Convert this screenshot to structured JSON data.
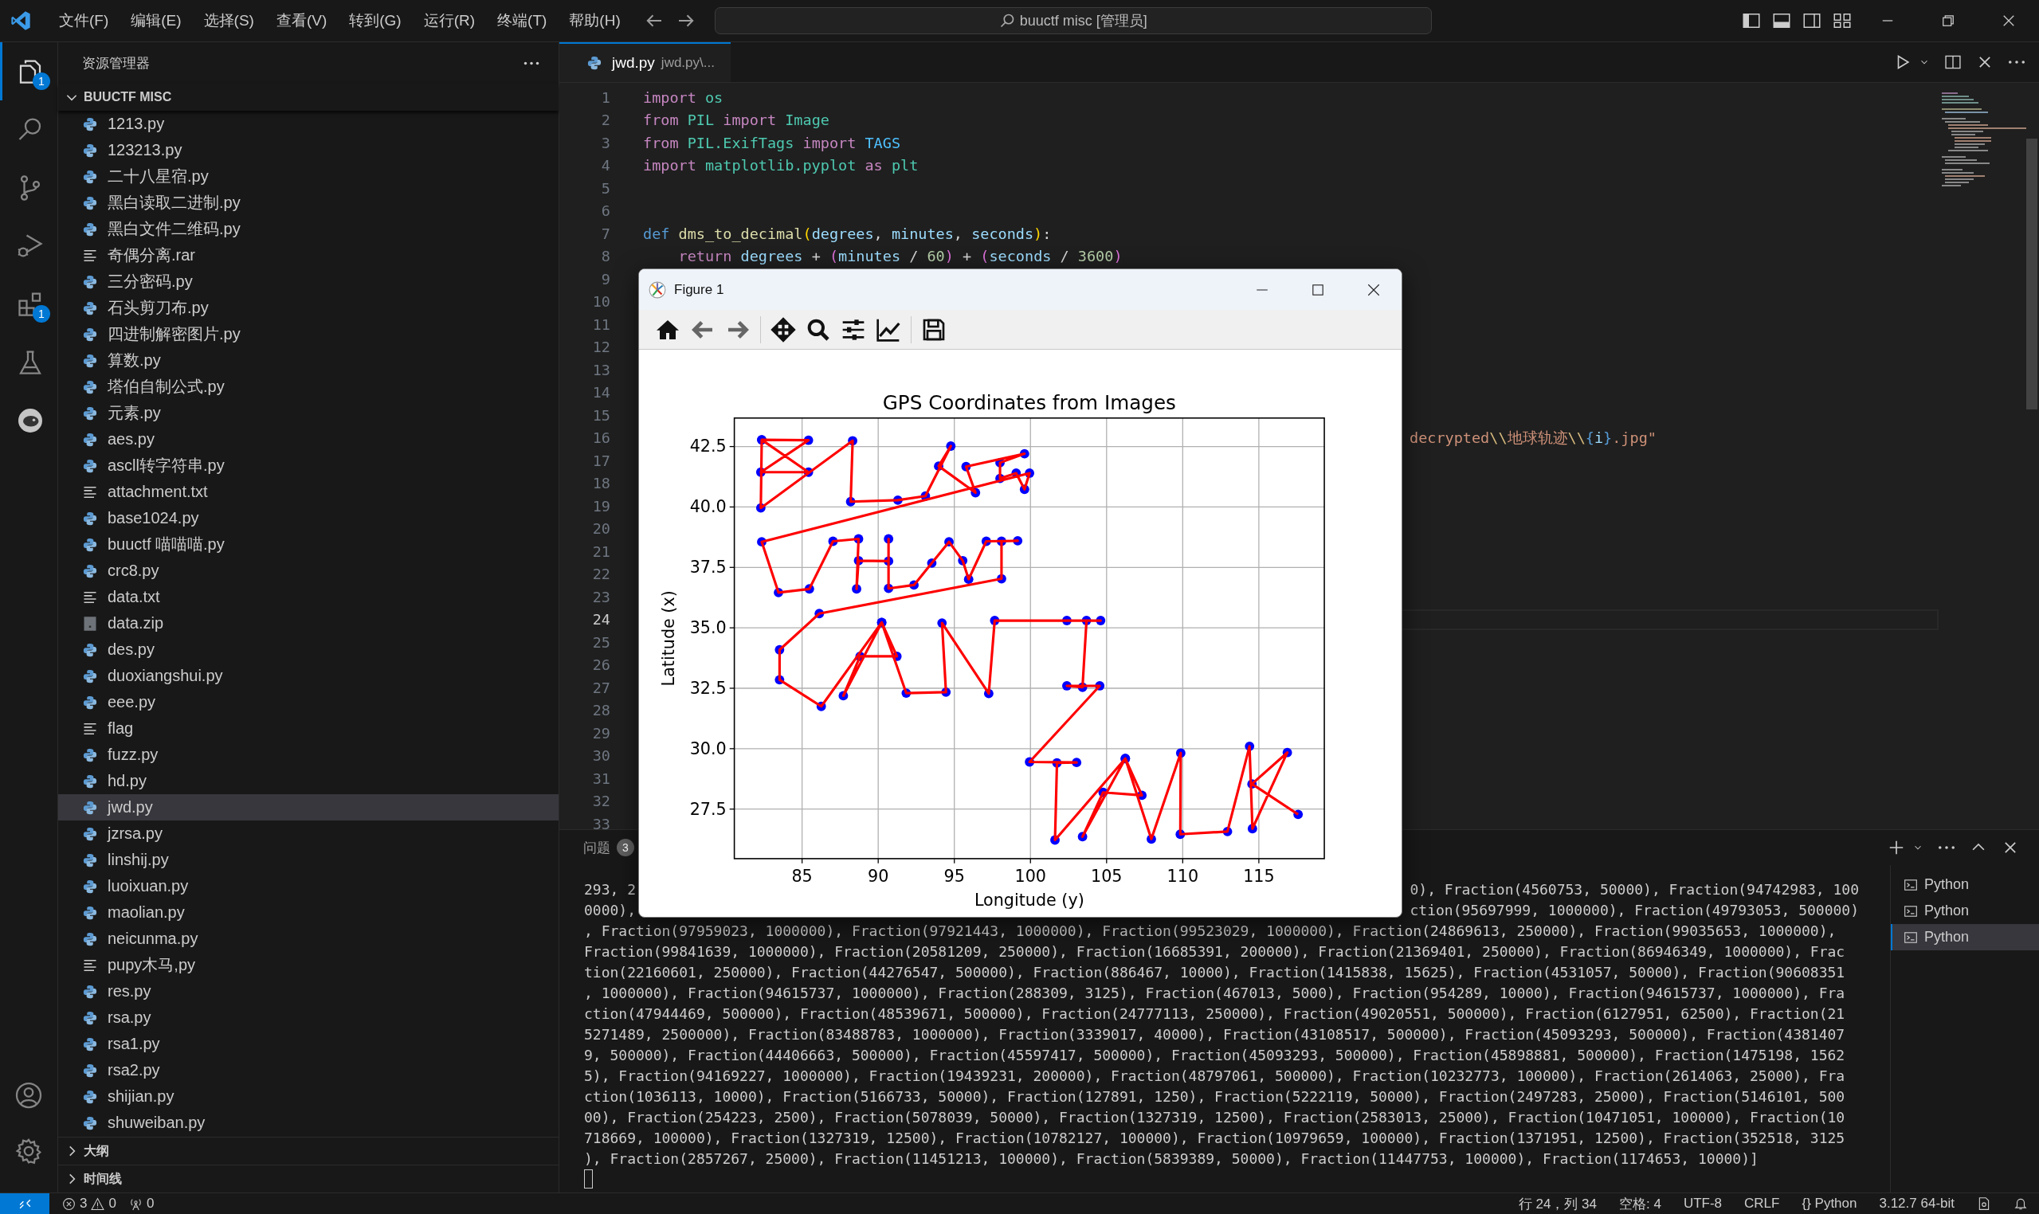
{
  "titlebar": {
    "menus": [
      "文件(F)",
      "编辑(E)",
      "选择(S)",
      "查看(V)",
      "转到(G)",
      "运行(R)",
      "终端(T)",
      "帮助(H)"
    ],
    "search": "buuctf misc [管理员]"
  },
  "activity_bar": {
    "items": [
      {
        "kind": "files",
        "badge": "1",
        "selected": true
      },
      {
        "kind": "search",
        "selected": false
      },
      {
        "kind": "source-control",
        "selected": false
      },
      {
        "kind": "run-debug",
        "selected": false
      },
      {
        "kind": "extensions",
        "badge": "1",
        "selected": false
      },
      {
        "kind": "testing",
        "selected": false
      },
      {
        "kind": "round-logo",
        "selected": false
      }
    ]
  },
  "sidebar": {
    "title": "资源管理器",
    "section": {
      "title": "BUUCTF MISC",
      "expanded": true
    },
    "files": [
      {
        "name": "1213.py",
        "kind": "python",
        "selected": false
      },
      {
        "name": "123213.py",
        "kind": "python",
        "selected": false
      },
      {
        "name": "二十八星宿.py",
        "kind": "python",
        "selected": false
      },
      {
        "name": "黑白读取二进制.py",
        "kind": "python",
        "selected": false
      },
      {
        "name": "黑白文件二维码.py",
        "kind": "python",
        "selected": false
      },
      {
        "name": "奇偶分离.rar",
        "kind": "text",
        "selected": false
      },
      {
        "name": "三分密码.py",
        "kind": "python",
        "selected": false
      },
      {
        "name": "石头剪刀布.py",
        "kind": "python",
        "selected": false
      },
      {
        "name": "四进制解密图片.py",
        "kind": "python",
        "selected": false
      },
      {
        "name": "算数.py",
        "kind": "python",
        "selected": false
      },
      {
        "name": "塔伯自制公式.py",
        "kind": "python",
        "selected": false
      },
      {
        "name": "元素.py",
        "kind": "python",
        "selected": false
      },
      {
        "name": "aes.py",
        "kind": "python",
        "selected": false
      },
      {
        "name": "ascll转字符串.py",
        "kind": "python",
        "selected": false
      },
      {
        "name": "attachment.txt",
        "kind": "text",
        "selected": false
      },
      {
        "name": "base1024.py",
        "kind": "python",
        "selected": false
      },
      {
        "name": "buuctf 喵喵喵.py",
        "kind": "python",
        "selected": false
      },
      {
        "name": "crc8.py",
        "kind": "python",
        "selected": false
      },
      {
        "name": "data.txt",
        "kind": "text",
        "selected": false
      },
      {
        "name": "data.zip",
        "kind": "archive",
        "selected": false
      },
      {
        "name": "des.py",
        "kind": "python",
        "selected": false
      },
      {
        "name": "duoxiangshui.py",
        "kind": "python",
        "selected": false
      },
      {
        "name": "eee.py",
        "kind": "python",
        "selected": false
      },
      {
        "name": "flag",
        "kind": "text",
        "selected": false
      },
      {
        "name": "fuzz.py",
        "kind": "python",
        "selected": false
      },
      {
        "name": "hd.py",
        "kind": "python",
        "selected": false
      },
      {
        "name": "jwd.py",
        "kind": "python",
        "selected": true
      },
      {
        "name": "jzrsa.py",
        "kind": "python",
        "selected": false
      },
      {
        "name": "linshij.py",
        "kind": "python",
        "selected": false
      },
      {
        "name": "luoixuan.py",
        "kind": "python",
        "selected": false
      },
      {
        "name": "maolian.py",
        "kind": "python",
        "selected": false
      },
      {
        "name": "neicunma.py",
        "kind": "python",
        "selected": false
      },
      {
        "name": "pupy木马,py",
        "kind": "text",
        "selected": false
      },
      {
        "name": "res.py",
        "kind": "python",
        "selected": false
      },
      {
        "name": "rsa.py",
        "kind": "python",
        "selected": false
      },
      {
        "name": "rsa1.py",
        "kind": "python",
        "selected": false
      },
      {
        "name": "rsa2.py",
        "kind": "python",
        "selected": false
      },
      {
        "name": "shijian.py",
        "kind": "python",
        "selected": false
      },
      {
        "name": "shuweiban.py",
        "kind": "python",
        "selected": false
      }
    ],
    "collapsed_sections": [
      {
        "title": "大纲",
        "expanded": false
      },
      {
        "title": "时间线",
        "expanded": false
      }
    ]
  },
  "editor": {
    "tab": {
      "name": "jwd.py",
      "path": "jwd.py\\..."
    },
    "lines": [
      {
        "n": "1",
        "current": false,
        "kind": "full",
        "tokens": [
          {
            "kind": "kw",
            "text": "import "
          },
          {
            "kind": "mod",
            "text": "os"
          }
        ]
      },
      {
        "n": "2",
        "current": false,
        "kind": "full",
        "tokens": [
          {
            "kind": "kw",
            "text": "from "
          },
          {
            "kind": "mod",
            "text": "PIL "
          },
          {
            "kind": "kw",
            "text": "import "
          },
          {
            "kind": "mod",
            "text": "Image"
          }
        ]
      },
      {
        "n": "3",
        "current": false,
        "kind": "full",
        "tokens": [
          {
            "kind": "kw",
            "text": "from "
          },
          {
            "kind": "mod",
            "text": "PIL.ExifTags "
          },
          {
            "kind": "kw",
            "text": "import "
          },
          {
            "kind": "const",
            "text": "TAGS"
          }
        ]
      },
      {
        "n": "4",
        "current": false,
        "kind": "full",
        "tokens": [
          {
            "kind": "kw",
            "text": "import "
          },
          {
            "kind": "mod",
            "text": "matplotlib.pyplot "
          },
          {
            "kind": "kw",
            "text": "as "
          },
          {
            "kind": "mod",
            "text": "plt"
          }
        ]
      },
      {
        "n": "5",
        "current": false,
        "kind": "full"
      },
      {
        "n": "6",
        "current": false,
        "kind": "full"
      },
      {
        "n": "7",
        "current": false,
        "kind": "full",
        "tokens": [
          {
            "kind": "def",
            "text": "def "
          },
          {
            "kind": "func",
            "text": "dms_to_decimal"
          },
          {
            "kind": "paren",
            "text": "("
          },
          {
            "kind": "var",
            "text": "degrees"
          },
          {
            "kind": "plain",
            "text": ", "
          },
          {
            "kind": "var",
            "text": "minutes"
          },
          {
            "kind": "plain",
            "text": ", "
          },
          {
            "kind": "var",
            "text": "seconds"
          },
          {
            "kind": "paren",
            "text": ")"
          },
          {
            "kind": "plain",
            "text": ":"
          }
        ]
      },
      {
        "n": "8",
        "current": false,
        "kind": "full",
        "tokens": [
          {
            "kind": "kw",
            "text": "    return "
          },
          {
            "kind": "var",
            "text": "degrees"
          },
          {
            "kind": "plain",
            "text": " + "
          },
          {
            "kind": "paren2",
            "text": "("
          },
          {
            "kind": "var",
            "text": "minutes"
          },
          {
            "kind": "plain",
            "text": " / "
          },
          {
            "kind": "num",
            "text": "60"
          },
          {
            "kind": "paren2",
            "text": ")"
          },
          {
            "kind": "plain",
            "text": " + "
          },
          {
            "kind": "paren2",
            "text": "("
          },
          {
            "kind": "var",
            "text": "seconds"
          },
          {
            "kind": "plain",
            "text": " / "
          },
          {
            "kind": "num",
            "text": "3600"
          },
          {
            "kind": "paren2",
            "text": ")"
          }
        ]
      },
      {
        "n": "9",
        "current": false,
        "kind": "full"
      },
      {
        "n": "10",
        "current": false,
        "kind": "full"
      },
      {
        "n": "11",
        "current": false,
        "kind": "full"
      },
      {
        "n": "12",
        "current": false,
        "kind": "full"
      },
      {
        "n": "13",
        "current": false,
        "kind": "full"
      },
      {
        "n": "14",
        "current": false,
        "kind": "full"
      },
      {
        "n": "15",
        "current": false,
        "kind": "full"
      },
      {
        "n": "16",
        "current": false,
        "kind": "tail",
        "tokens": [
          {
            "kind": "str",
            "text": "decrypted"
          },
          {
            "kind": "esc",
            "text": "\\\\"
          },
          {
            "kind": "str",
            "text": "地球轨迹"
          },
          {
            "kind": "esc",
            "text": "\\\\"
          },
          {
            "kind": "brace",
            "text": "{"
          },
          {
            "kind": "var",
            "text": "i"
          },
          {
            "kind": "brace",
            "text": "}"
          },
          {
            "kind": "str",
            "text": ".jpg\""
          }
        ]
      },
      {
        "n": "17",
        "current": false,
        "kind": "full"
      },
      {
        "n": "18",
        "current": false,
        "kind": "full"
      },
      {
        "n": "19",
        "current": false,
        "kind": "full"
      },
      {
        "n": "20",
        "current": false,
        "kind": "full"
      },
      {
        "n": "21",
        "current": false,
        "kind": "full"
      },
      {
        "n": "22",
        "current": false,
        "kind": "full"
      },
      {
        "n": "23",
        "current": false,
        "kind": "full"
      },
      {
        "n": "24",
        "current": true,
        "kind": "full"
      },
      {
        "n": "25",
        "current": false,
        "kind": "full"
      },
      {
        "n": "26",
        "current": false,
        "kind": "full"
      },
      {
        "n": "27",
        "current": false,
        "kind": "full"
      },
      {
        "n": "28",
        "current": false,
        "kind": "full"
      },
      {
        "n": "29",
        "current": false,
        "kind": "full"
      },
      {
        "n": "30",
        "current": false,
        "kind": "full"
      },
      {
        "n": "31",
        "current": false,
        "kind": "full"
      },
      {
        "n": "32",
        "current": false,
        "kind": "full"
      },
      {
        "n": "33",
        "current": false,
        "kind": "full"
      }
    ]
  },
  "panel": {
    "tabs": [
      {
        "label": "问题",
        "badge": "3",
        "selected": false
      }
    ],
    "terminal_lines": [
      {
        "segments": [
          "293, 2",
          "0), Fraction(4560753, 50000), Fraction(94742983, 100"
        ]
      },
      {
        "segments": [
          "0000),",
          "ction(95697999, 1000000), Fraction(49793053, 500000)"
        ]
      },
      {
        "segments": [
          ", Fraction(97959023, 1000000), Fraction(97921443, 1000000), Fraction(99523029, 1000000), Fraction(24869613, 250000), Fraction(99035653, 1000000),"
        ]
      },
      {
        "segments": [
          "Fraction(99841639, 1000000), Fraction(20581209, 250000), Fraction(16685391, 200000), Fraction(21369401, 250000), Fraction(86946349, 1000000), Frac"
        ]
      },
      {
        "segments": [
          "tion(22160601, 250000), Fraction(44276547, 500000), Fraction(886467, 10000), Fraction(1415838, 15625), Fraction(4531057, 50000), Fraction(90608351"
        ]
      },
      {
        "segments": [
          ", 1000000), Fraction(94615737, 1000000), Fraction(288309, 3125), Fraction(467013, 5000), Fraction(954289, 10000), Fraction(94615737, 1000000), Fra"
        ]
      },
      {
        "segments": [
          "ction(47944469, 500000), Fraction(48539671, 500000), Fraction(24777113, 250000), Fraction(49020551, 500000), Fraction(6127951, 62500), Fraction(21"
        ]
      },
      {
        "segments": [
          "5271489, 2500000), Fraction(83488783, 1000000), Fraction(3339017, 40000), Fraction(43108517, 500000), Fraction(45093293, 500000), Fraction(4381407"
        ]
      },
      {
        "segments": [
          "9, 500000), Fraction(44406663, 500000), Fraction(45597417, 500000), Fraction(45093293, 500000), Fraction(45898881, 500000), Fraction(1475198, 1562"
        ]
      },
      {
        "segments": [
          "5), Fraction(94169227, 1000000), Fraction(19439231, 200000), Fraction(48797061, 500000), Fraction(10232773, 100000), Fraction(2614063, 25000), Fra"
        ]
      },
      {
        "segments": [
          "ction(1036113, 10000), Fraction(5166733, 50000), Fraction(127891, 1250), Fraction(5222119, 50000), Fraction(2497283, 25000), Fraction(5146101, 500"
        ]
      },
      {
        "segments": [
          "00), Fraction(254223, 2500), Fraction(5078039, 50000), Fraction(1327319, 12500), Fraction(2583013, 25000), Fraction(10471051, 100000), Fraction(10"
        ]
      },
      {
        "segments": [
          "718669, 100000), Fraction(1327319, 12500), Fraction(10782127, 100000), Fraction(10979659, 100000), Fraction(1371951, 12500), Fraction(352518, 3125"
        ]
      },
      {
        "segments": [
          "), Fraction(2857267, 25000), Fraction(11451213, 100000), Fraction(5839389, 50000), Fraction(11447753, 100000), Fraction(1174653, 10000)]"
        ]
      }
    ],
    "terminals": [
      {
        "label": "Python",
        "selected": false
      },
      {
        "label": "Python",
        "selected": false
      },
      {
        "label": "Python",
        "selected": true
      }
    ]
  },
  "figure": {
    "title": "Figure 1",
    "chart_data": {
      "type": "line",
      "title": "GPS Coordinates from Images",
      "xlabel": "Longitude (y)",
      "ylabel": "Latitude (x)",
      "x": [
        82.35,
        85.42,
        82.29,
        85.42,
        82.35,
        82.29,
        88.32,
        88.19,
        91.29,
        93.1,
        94.77,
        93.97,
        96.39,
        95.77,
        99.61,
        98.0,
        98.0,
        99.06,
        99.61,
        99.94,
        82.35,
        83.45,
        85.48,
        87.03,
        88.71,
        88.58,
        88.71,
        90.68,
        90.68,
        90.68,
        92.35,
        93.52,
        94.65,
        95.55,
        95.94,
        97.1,
        99.16,
        98.1,
        98.1,
        86.13,
        83.52,
        83.52,
        86.26,
        90.23,
        87.71,
        88.81,
        91.23,
        90.23,
        91.84,
        94.45,
        94.19,
        97.26,
        97.65,
        102.39,
        104.61,
        103.68,
        103.42,
        102.39,
        104.55,
        99.94,
        103.03,
        101.74,
        101.61,
        106.23,
        103.42,
        104.77,
        107.32,
        106.23,
        107.94,
        109.87,
        109.84,
        112.94,
        114.39,
        114.58,
        116.87,
        114.55,
        117.58
      ],
      "series": [
        {
          "color": "#ff0000",
          "marker": "o",
          "values": [
            42.78,
            42.76,
            41.44,
            41.44,
            42.78,
            39.96,
            42.74,
            40.22,
            40.28,
            40.45,
            42.52,
            41.69,
            40.59,
            41.67,
            42.2,
            41.83,
            41.18,
            41.4,
            40.73,
            41.4,
            38.56,
            36.46,
            36.61,
            38.58,
            38.68,
            36.61,
            37.78,
            37.76,
            38.68,
            36.63,
            36.77,
            37.68,
            38.56,
            37.78,
            37.01,
            38.58,
            38.6,
            38.58,
            37.03,
            35.59,
            34.09,
            32.85,
            31.75,
            35.22,
            32.19,
            33.82,
            33.82,
            35.22,
            32.3,
            32.34,
            35.2,
            32.28,
            35.3,
            35.3,
            35.3,
            35.3,
            32.54,
            32.6,
            32.6,
            29.45,
            29.43,
            29.41,
            26.22,
            29.59,
            26.36,
            28.19,
            28.07,
            29.59,
            26.26,
            29.82,
            26.46,
            26.57,
            30.1,
            26.69,
            29.84,
            28.54,
            27.28
          ]
        }
      ],
      "xlim": [
        80.55,
        119.3
      ],
      "ylim": [
        25.45,
        43.68
      ],
      "xticks": [
        85,
        90,
        95,
        100,
        105,
        110,
        115
      ],
      "yticks": [
        27.5,
        {
          "value": 30,
          "label": "30.0"
        },
        32.5,
        {
          "value": 35,
          "label": "35.0"
        },
        37.5,
        {
          "value": 40,
          "label": "40.0"
        },
        42.5
      ],
      "grid": true
    }
  },
  "status_bar": {
    "errors": "3",
    "warnings": "0",
    "ports": "0",
    "position": "行 24，列 34",
    "indent": "空格: 4",
    "encoding": "UTF-8",
    "eol": "CRLF",
    "language_mark": "{}",
    "language": "Python",
    "interpreter": "3.12.7 64-bit"
  }
}
